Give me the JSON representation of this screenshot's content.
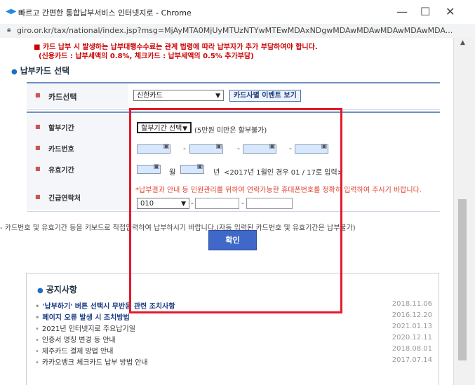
{
  "window": {
    "title": "빠르고 간편한 통합납부서비스 인터넷지로 - Chrome",
    "minimize": "—",
    "maximize": "☐",
    "close": "✕"
  },
  "address_bar": {
    "url": "giro.or.kr/tax/national/index.jsp?msg=MjAyMTA0MjUyMTUzNTYwMTEwMDAxNDgwMDAwMDAwMDAwMDAwMDA..."
  },
  "notice_top": {
    "line1": "카드 납부 시 발생하는 납부대행수수료는 관계 법령에 따라 납부자가 추가 부담하여야 합니다.",
    "line2": "(신용카드 : 납부세액의 0.8%, 체크카드 : 납부세액의 0.5% 추가부담)"
  },
  "section_card_select": {
    "title": "납부카드 선택",
    "card_label": "카드선택",
    "card_value": "신한카드",
    "event_button": "카드사별 이벤트 보기"
  },
  "form": {
    "installment_label": "할부기간",
    "installment_value": "할부기간 선택",
    "installment_note": "(5만원 미만은 할부불가)",
    "card_number_label": "카드번호",
    "card_dash": "-",
    "expiry_label": "유효기간",
    "expiry_month": "월",
    "expiry_year": "년",
    "expiry_note": "<2017년 1월인 경우 01 / 17로 입력>",
    "phone_label": "긴급연락처",
    "phone_note": "*납부결과 안내 등 민원관리를 위하여 연락가능한 휴대폰번호를 정확히 입력하여 주시기 바랍니다.",
    "phone_prefix": "010",
    "phone_dash": "-"
  },
  "help_text": "- 카드번호 및 유효기간 등을 키보드로 직접입력하여 납부하시기 바랍니다.(자동 입력된 카드번호 및 유효기간은 납부불가)",
  "confirm_button": "확인",
  "notices": {
    "title": "공지사항",
    "items": [
      {
        "title": "'납부하기' 버튼 선택시 무반응 관련 조치사항",
        "date": "2018.11.06",
        "bold": true
      },
      {
        "title": "페이지 오류 발생 시 조치방법",
        "date": "2016.12.20",
        "bold": true
      },
      {
        "title": "2021년 인터넷지로 주요납기일",
        "date": "2021.01.13",
        "bold": false
      },
      {
        "title": "인증서 명칭 변경 등 안내",
        "date": "2020.12.11",
        "bold": false
      },
      {
        "title": "제주카드 결제 방법 안내",
        "date": "2018.08.01",
        "bold": false
      },
      {
        "title": "카카오뱅크 체크카드 납부 방법 안내",
        "date": "2017.07.14",
        "bold": false
      }
    ]
  },
  "colors": {
    "highlight": "#e3192b",
    "accent": "#3f68c8",
    "notice_red": "#cc0000"
  }
}
